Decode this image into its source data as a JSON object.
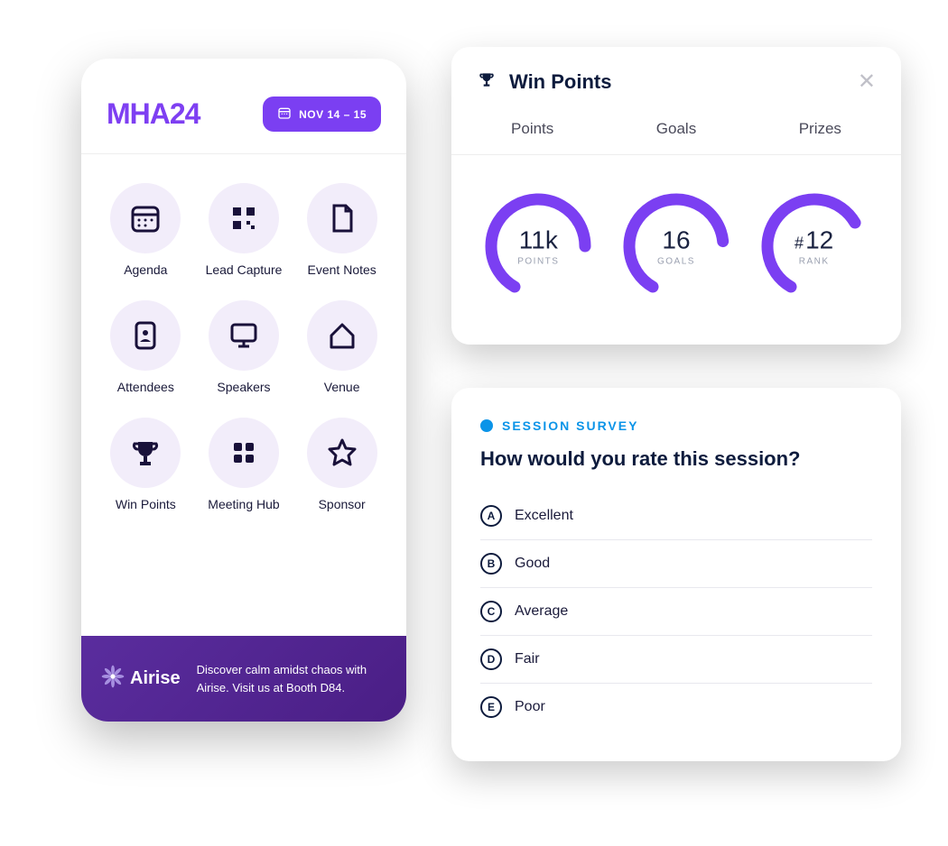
{
  "phone": {
    "logo": "MHA24",
    "date_label": "NOV 14 – 15",
    "grid": [
      {
        "label": "Agenda",
        "icon": "calendar"
      },
      {
        "label": "Lead Capture",
        "icon": "qrcode"
      },
      {
        "label": "Event Notes",
        "icon": "document"
      },
      {
        "label": "Attendees",
        "icon": "badge"
      },
      {
        "label": "Speakers",
        "icon": "monitor"
      },
      {
        "label": "Venue",
        "icon": "home"
      },
      {
        "label": "Win Points",
        "icon": "trophy"
      },
      {
        "label": "Meeting Hub",
        "icon": "tiles"
      },
      {
        "label": "Sponsor",
        "icon": "star"
      }
    ],
    "banner": {
      "brand": "Airise",
      "text": "Discover calm amidst chaos with Airise. Visit us at Booth D84."
    }
  },
  "points_card": {
    "title": "Win Points",
    "tabs": [
      "Points",
      "Goals",
      "Prizes"
    ],
    "gauges": [
      {
        "value": "11k",
        "label": "POINTS",
        "hash": false,
        "progress": 0.8
      },
      {
        "value": "16",
        "label": "GOALS",
        "hash": false,
        "progress": 0.78
      },
      {
        "value": "12",
        "label": "RANK",
        "hash": true,
        "progress": 0.7
      }
    ]
  },
  "survey": {
    "tag": "SESSION SURVEY",
    "question": "How would you rate this session?",
    "options": [
      {
        "letter": "A",
        "text": "Excellent"
      },
      {
        "letter": "B",
        "text": "Good"
      },
      {
        "letter": "C",
        "text": "Average"
      },
      {
        "letter": "D",
        "text": "Fair"
      },
      {
        "letter": "E",
        "text": "Poor"
      }
    ]
  }
}
